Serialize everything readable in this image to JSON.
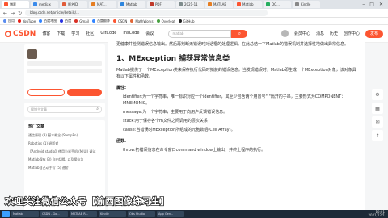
{
  "browser": {
    "tabs": [
      {
        "label": "博客",
        "color": "#fc5531"
      },
      {
        "label": "mediax",
        "color": "#3b8beb"
      },
      {
        "label": "报名ID",
        "color": "#e15c3a"
      },
      {
        "label": "MAT...",
        "color": "#e67e22"
      },
      {
        "label": "Matlab",
        "color": "#2e86de"
      },
      {
        "label": "PDF",
        "color": "#c0392b"
      },
      {
        "label": "2021-11",
        "color": "#7f8c8d"
      },
      {
        "label": "MATLAB",
        "color": "#e67e22"
      },
      {
        "label": "Matlab",
        "color": "#fc5531"
      },
      {
        "label": "DO...",
        "color": "#27ae60"
      },
      {
        "label": "Kindle",
        "color": "#888"
      }
    ],
    "url": "blog.csdn.net/article/details/...",
    "bookmarks": [
      {
        "label": "应用",
        "color": "#5b8def"
      },
      {
        "label": "YouTube",
        "color": "#e62117"
      },
      {
        "label": "百度地图",
        "color": "#3385ff"
      },
      {
        "label": "百度",
        "color": "#2932e1"
      },
      {
        "label": "Gmail",
        "color": "#d93025"
      },
      {
        "label": "百度翻译",
        "color": "#3385ff"
      },
      {
        "label": "CSDN",
        "color": "#fc5531"
      },
      {
        "label": "MathWorks",
        "color": "#e16737"
      },
      {
        "label": "Overleaf",
        "color": "#47a141"
      },
      {
        "label": "GitHub",
        "color": "#222"
      }
    ]
  },
  "csdn": {
    "logo": "CSDN",
    "nav": [
      "博客",
      "下载",
      "学习",
      "社区",
      "GitCode",
      "InsCode",
      "会议"
    ],
    "search_placeholder": "matlab",
    "right_nav": [
      "会员中心",
      "消息",
      "历史",
      "创作中心"
    ],
    "create_label": "发布"
  },
  "sidebar": {
    "search_placeholder": "搜博主文章",
    "hot_title": "热门文章",
    "hot_items": [
      "通信原理 (3) 基本概念 (SampEn)",
      "Robotics (1) 退斯对",
      "【Android studio】使用小米手机 (MIUI) 调试",
      "Matlab保存 (3) 自由切换, 以及保存为",
      "Matlab自己动手写 (5) 进阶"
    ]
  },
  "article": {
    "intro": "更健康并检测错误信息输出。然后再判断无错误时对话框的处理逻辑。在此总结一下Matlab的错误机制并选择性地做出异常信息。",
    "heading": "1、MException 捕获异常信息类",
    "desc": "Matlab提供了一个MException类来保存执行代码时捕获的错误信息。当发现错误时，Matlab即生成一个MException对象，该对象具有以下属性和函数。",
    "props_label": "属性:",
    "props": [
      "identifier:为一个字符串，唯一标识对应一个identifier，其至少包含两个用冒号\":\"隔开的子串，主要形式为COMPONENT：MNEMONIC。",
      "message:为一个字符串，主要用于向用户反馈错误信息。",
      "stack:用于保存各个m文件之间调用的层次关系",
      "cause:当错误时MException所组成的元胞数组(Cell Array)。"
    ],
    "funcs_label": "函数:",
    "funcs": [
      "throw:扔错误信息在命令窗口command window上输出，并终止程序的执行。"
    ]
  },
  "right_tools": [
    "gear-icon",
    "grid-icon",
    "chat-icon",
    "arrow-up-icon"
  ],
  "subtitle": "欢迎关注微信公众号【谕西图像练习生】",
  "taskbar": {
    "windows": [
      "Matlab",
      "CSDN - Go...",
      "MATLAB R...",
      "Kindle",
      "Obs Studio",
      "App Gen..."
    ],
    "time": "10:01",
    "date": "2021/12/1"
  }
}
